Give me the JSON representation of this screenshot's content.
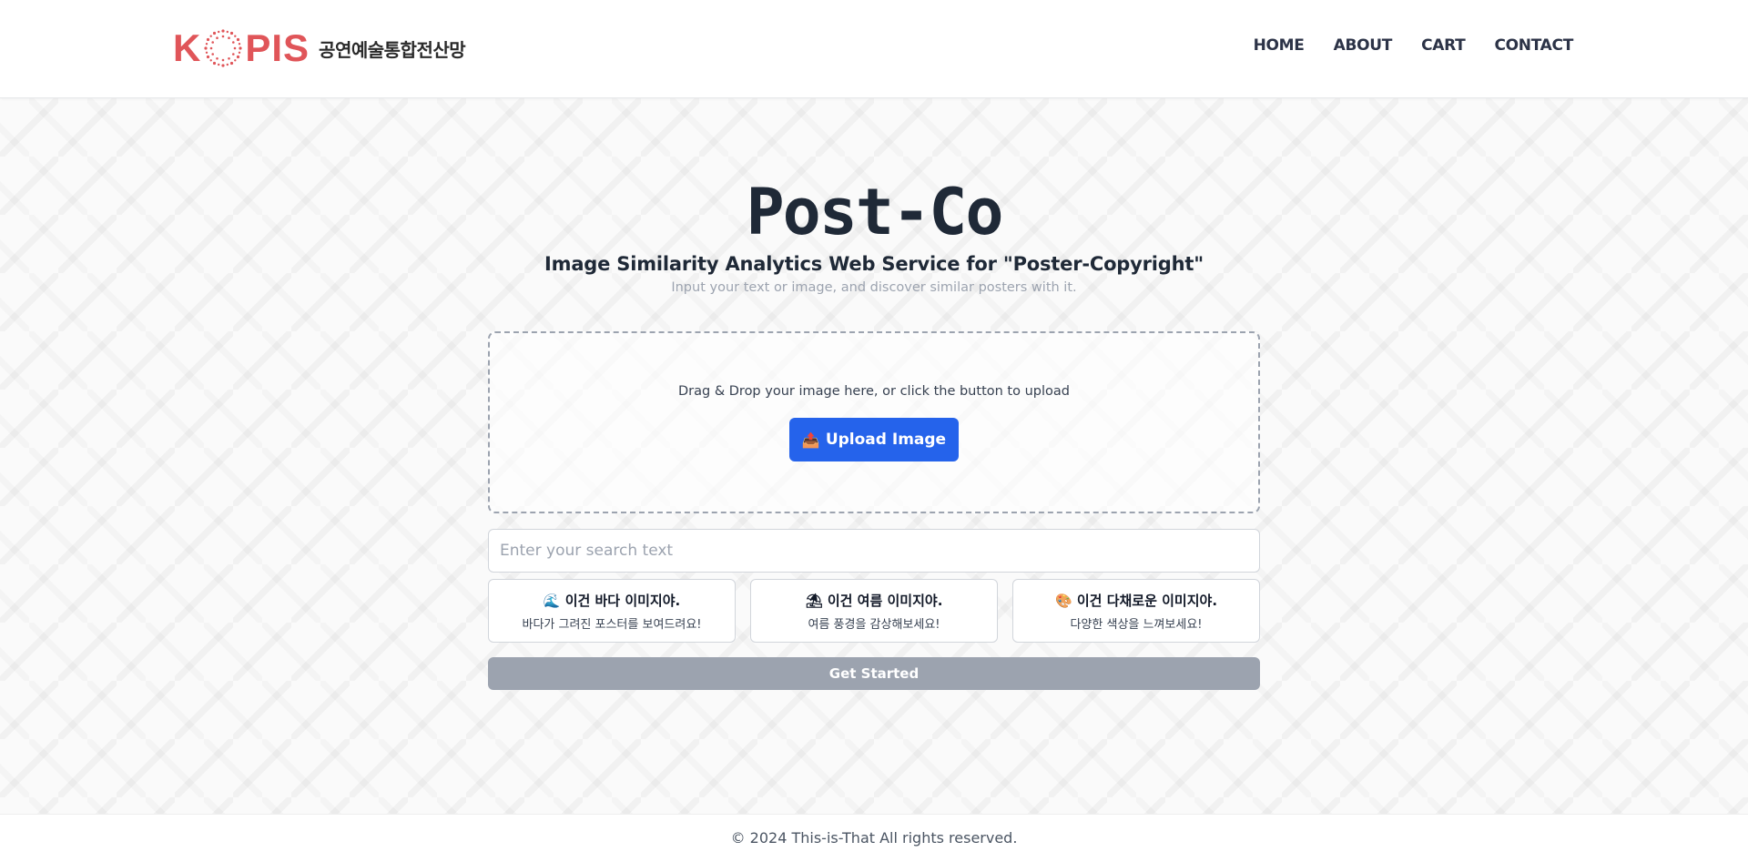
{
  "header": {
    "logo_text_left": "K",
    "logo_text_right": "PIS",
    "logo_subtitle": "공연예술통합전산망",
    "nav": [
      "HOME",
      "ABOUT",
      "CART",
      "CONTACT"
    ]
  },
  "hero": {
    "title": "Post-Co",
    "subtitle": "Image Similarity Analytics Web Service for \"Poster-Copyright\"",
    "tagline": "Input your text or image, and discover similar posters with it."
  },
  "dropzone": {
    "instruction": "Drag & Drop your image here, or click the button to upload",
    "upload_icon": "📤",
    "upload_label": "Upload Image"
  },
  "search": {
    "placeholder": "Enter your search text",
    "value": ""
  },
  "suggestions": [
    {
      "icon": "🌊",
      "title": "이건 바다 이미지야.",
      "subtitle": "바다가 그려진 포스터를 보여드려요!"
    },
    {
      "icon": "⛱",
      "title": "이건 여름 이미지야.",
      "subtitle": "여름 풍경을 감상해보세요!"
    },
    {
      "icon": "🎨",
      "title": "이건 다채로운 이미지야.",
      "subtitle": "다양한 색상을 느껴보세요!"
    }
  ],
  "actions": {
    "get_started": "Get Started"
  },
  "footer": {
    "copyright": "© 2024 This-is-That All rights reserved."
  },
  "colors": {
    "brand": "#e05559",
    "primary_button": "#2563eb",
    "disabled_button": "#9ca3af"
  }
}
